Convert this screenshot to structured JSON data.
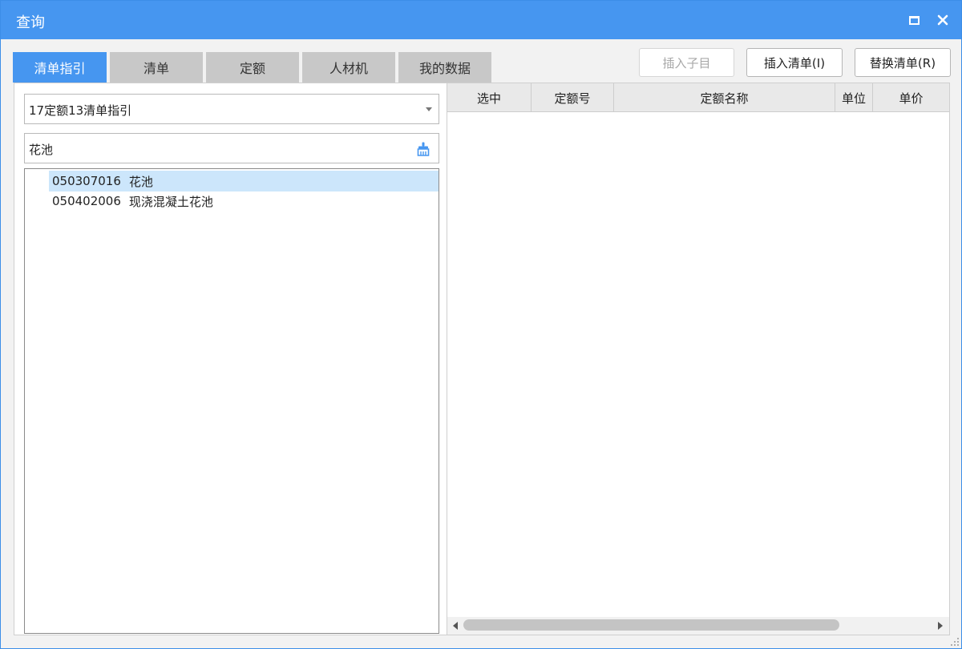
{
  "window": {
    "title": "查询"
  },
  "tabs": [
    {
      "label": "清单指引",
      "active": true
    },
    {
      "label": "清单",
      "active": false
    },
    {
      "label": "定额",
      "active": false
    },
    {
      "label": "人材机",
      "active": false
    },
    {
      "label": "我的数据",
      "active": false
    }
  ],
  "toolbar": {
    "insert_sub_label": "插入子目",
    "insert_list_label": "插入清单(I)",
    "replace_list_label": "替换清单(R)"
  },
  "left": {
    "dropdown_value": "17定额13清单指引",
    "search_value": "花池",
    "items": [
      {
        "code": "050307016",
        "name": "花池",
        "selected": true
      },
      {
        "code": "050402006",
        "name": "现浇混凝土花池",
        "selected": false
      }
    ]
  },
  "table": {
    "columns": [
      "选中",
      "定额号",
      "定额名称",
      "单位",
      "单价"
    ],
    "rows": []
  },
  "colors": {
    "accent": "#4696f0",
    "selected_row": "#cce6fb",
    "tab_inactive": "#c8c8c8"
  }
}
